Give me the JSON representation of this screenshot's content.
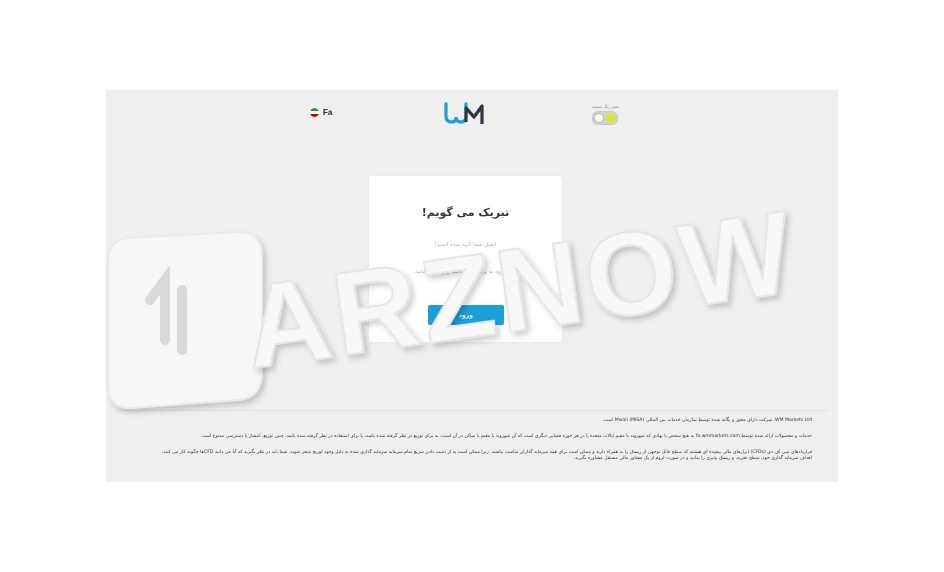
{
  "header": {
    "lang_label": "Fa",
    "logo_text": "WM",
    "theme_toggle_label": "تغییر رنگ صفحه"
  },
  "card": {
    "title": "تبریک می گویم!",
    "line1": "ایمیل شما تأیید شده است!",
    "line2": "برای ورود به پرتال روی دکمه زیر کلیک نمایید.",
    "login_button": "ورود"
  },
  "footer": {
    "line1": "WM Markets Ltd، شرکت دارای مجوز و یگانه شده توسط سازمان خدمات بین المللی Mwali (MISA) است.",
    "line2": "خدمات و محصولات ارائه شده توسط fa.wmmarkets.com به هیچ شخص یا نهادی که شهروند یا مقیم ایالات متحده یا در هر حوزه قضایی دیگری است که آن شهروند یا مقیم یا ساکن در آن است، به برای توزیع در نظر گرفته شده باشد، یا برای استفاده در نظر گرفته شده باشد، چنین توزیع، انتشار یا دسترسی ممنوع است.",
    "line3": "قراردادهای سی اف دی (CFDs) ابزارهای مالی پیچیده ای هستند که سطح قابل توجهی از ریسک را به همراه دارند و ممکن است برای همه سرمایه گذاران مناسب نباشند. زیرا ممکن است به از دست دادن سریع تمام سرمایه سرمایه گذاری شده به دلیل وجود لوریج منجر شوند. شما باید در نظر بگیرید که آیا می دانید CFDها چگونه کار می کنند،",
    "line4": "اهداف سرمایه گذاری خود، سطح تجربه، و ریسک پذیری را بدانید و در صورت لزوم از یک مشاور مالی مستقل مشاوره بگیرید."
  },
  "watermark": {
    "text": "ARZNOW"
  },
  "colors": {
    "primary": "#1a9fd8",
    "background": "#efefef",
    "card": "#ffffff"
  }
}
